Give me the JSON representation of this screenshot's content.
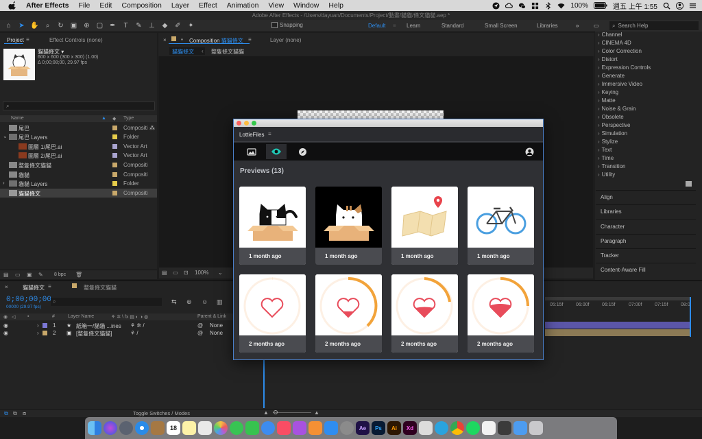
{
  "menubar": {
    "app_name": "After Effects",
    "items": [
      "File",
      "Edit",
      "Composition",
      "Layer",
      "Effect",
      "Animation",
      "View",
      "Window",
      "Help"
    ],
    "battery": "100%",
    "clock": "週五 上午 1:55"
  },
  "window_title": "Adobe After Effects - /Users/dayuan/Documents/Project/動畫/貓貓/條文貓貓.aep *",
  "toolbar": {
    "snapping_label": "Snapping",
    "workspaces": [
      "Default",
      "Learn",
      "Standard",
      "Small Screen",
      "Libraries"
    ],
    "active_workspace": "Default",
    "search_placeholder": "Search Help"
  },
  "project_panel": {
    "tab_project": "Project",
    "tab_effect_controls": "Effect Controls (none)",
    "selected_name": "貓貓條文 ▾",
    "selected_dims": "600 x 600  (300 x 300) (1.00)",
    "selected_duration": "Δ 0;00;08;00, 29.97 fps",
    "col_name": "Name",
    "col_type": "Type",
    "rows": [
      {
        "name": "尾巴",
        "type": "Compositi",
        "label_color": "#c8a86a"
      },
      {
        "name": "尾巴 Layers",
        "type": "Folder",
        "label_color": "#e6cc4a"
      },
      {
        "name": "圖層 1/尾巴.ai",
        "type": "Vector Art",
        "label_color": "#a9a4cf"
      },
      {
        "name": "圖層 2/尾巴.ai",
        "type": "Vector Art",
        "label_color": "#a9a4cf"
      },
      {
        "name": "整隻條文貓貓",
        "type": "Compositi",
        "label_color": "#c8a86a"
      },
      {
        "name": "貓貓",
        "type": "Compositi",
        "label_color": "#c8a86a"
      },
      {
        "name": "貓貓 Layers",
        "type": "Folder",
        "label_color": "#e6cc4a"
      },
      {
        "name": "貓貓條文",
        "type": "Compositi",
        "label_color": "#c8a86a"
      }
    ],
    "bpc": "8 bpc"
  },
  "composition_panel": {
    "tab_label": "Composition",
    "comp_name": "貓貓條文",
    "layer_tab": "Layer (none)",
    "breadcrumb": [
      "貓貓條文",
      "整隻條文貓貓"
    ],
    "zoom": "100%"
  },
  "effects_panel": {
    "categories": [
      "Channel",
      "CINEMA 4D",
      "Color Correction",
      "Distort",
      "Expression Controls",
      "Generate",
      "Immersive Video",
      "Keying",
      "Matte",
      "Noise & Grain",
      "Obsolete",
      "Perspective",
      "Simulation",
      "Stylize",
      "Text",
      "Time",
      "Transition",
      "Utility"
    ],
    "side_panels": [
      "Align",
      "Libraries",
      "Character",
      "Paragraph",
      "Tracker",
      "Content-Aware Fill"
    ]
  },
  "timeline": {
    "tabs": [
      "貓貓條文",
      "整隻條文貓貓"
    ],
    "timecode": "0;00;00;00",
    "timecode_sub": "00000 (29.97 fps)",
    "col_layer_name": "Layer Name",
    "col_parent": "Parent & Link",
    "layers": [
      {
        "num": "1",
        "name": "紙箱一/貓貓 ...ines",
        "parent": "None",
        "color": "#7c78d6"
      },
      {
        "num": "2",
        "name": "[整隻條文貓貓]",
        "parent": "None",
        "color": "#c8a86a"
      }
    ],
    "ruler": [
      "05:15f",
      "06:00f",
      "06:15f",
      "07:00f",
      "07:15f",
      "08:0"
    ],
    "toggle_label": "Toggle Switches / Modes"
  },
  "lottiefiles": {
    "window_title": "LottieFiles",
    "previews_title": "Previews (13)",
    "cards": [
      {
        "caption": "1 month ago",
        "art": "cat-bw-box"
      },
      {
        "caption": "1 month ago",
        "art": "cat-tabby-box"
      },
      {
        "caption": "1 month ago",
        "art": "map-pin"
      },
      {
        "caption": "1 month ago",
        "art": "bicycle"
      },
      {
        "caption": "2 months ago",
        "art": "heart-ring-0"
      },
      {
        "caption": "2 months ago",
        "art": "heart-ring-1"
      },
      {
        "caption": "2 months ago",
        "art": "heart-ring-2"
      },
      {
        "caption": "2 months ago",
        "art": "heart-ring-3"
      }
    ]
  },
  "dock": {
    "apps": [
      "finder",
      "siri",
      "launchpad",
      "safari",
      "notes-brown",
      "calendar",
      "notes",
      "photos-alt",
      "photos",
      "messages",
      "facetime",
      "messenger",
      "music",
      "podcasts",
      "books",
      "app-store",
      "system-prefs",
      "Ae",
      "Ps",
      "Ai",
      "Xd",
      "preview",
      "telegram",
      "chrome",
      "spotify",
      "finder-doc",
      "network",
      "downloads",
      "trash"
    ],
    "calendar_day": "18"
  },
  "colors": {
    "accent": "#2d8ceb",
    "lottie_teal": "#1fc7b5",
    "heart_red": "#e84c5b",
    "ring_orange": "#f2a33a"
  }
}
